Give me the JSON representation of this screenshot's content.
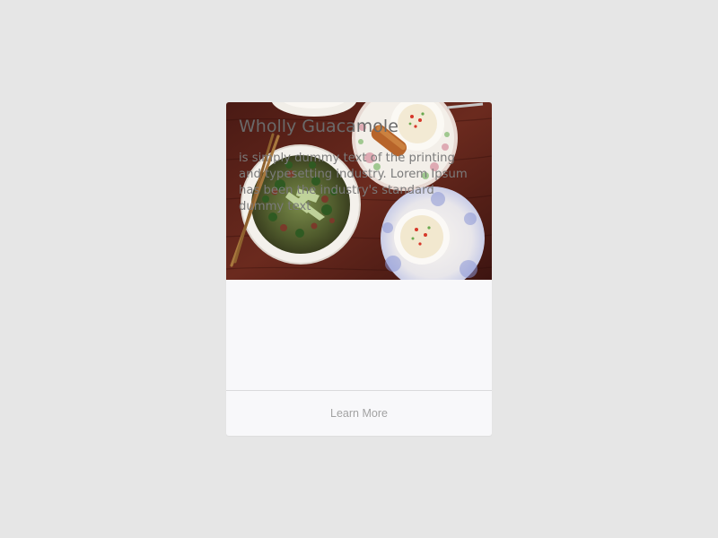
{
  "card": {
    "image_alt": "Bowls of pho with chopsticks and side dishes on a wooden table",
    "title": "Wholly Guacamole",
    "text": "is simply dummy text of the printing and typesetting industry. Lorem Ipsum has been the industry's standard dummy text",
    "button_label": "Learn More"
  },
  "colors": {
    "page_background": "#e6e6e6",
    "card_background": "#f8f8fa",
    "title_color": "#6a6a6a",
    "text_color": "#7b7b7b",
    "button_color": "#a2a2a2"
  }
}
